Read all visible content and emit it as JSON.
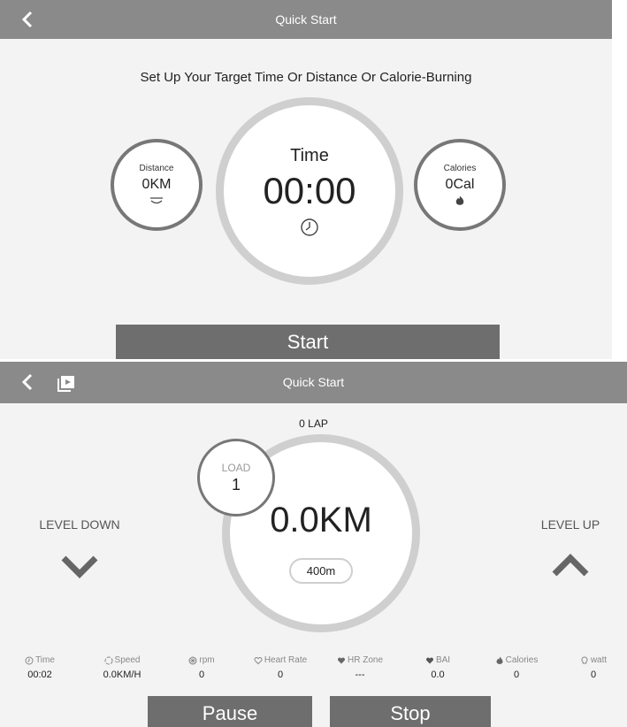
{
  "screen1": {
    "header": {
      "title": "Quick Start"
    },
    "subtitle": "Set Up Your Target Time Or Distance Or Calorie-Burning",
    "distance": {
      "label": "Distance",
      "value": "0KM",
      "icon": "road-icon"
    },
    "time": {
      "label": "Time",
      "value": "00:00",
      "icon": "clock-icon"
    },
    "calories": {
      "label": "Calories",
      "value": "0Cal",
      "icon": "flame-icon"
    },
    "start_label": "Start"
  },
  "screen2": {
    "header": {
      "title": "Quick Start"
    },
    "lap": "0 LAP",
    "load": {
      "label": "LOAD",
      "value": "1"
    },
    "distance_value": "0.0KM",
    "track_length": "400m",
    "level_down": "LEVEL DOWN",
    "level_up": "LEVEL UP",
    "stats": [
      {
        "label": "Time",
        "value": "00:02",
        "icon": "clock-icon"
      },
      {
        "label": "Speed",
        "value": "0.0KM/H",
        "icon": "speed-icon"
      },
      {
        "label": "rpm",
        "value": "0",
        "icon": "wheel-icon"
      },
      {
        "label": "Heart Rate",
        "value": "0",
        "icon": "heart-outline-icon"
      },
      {
        "label": "HR Zone",
        "value": "---",
        "icon": "heart-zone-icon"
      },
      {
        "label": "BAI",
        "value": "0.0",
        "icon": "heart-filled-icon"
      },
      {
        "label": "Calories",
        "value": "0",
        "icon": "flame-icon"
      },
      {
        "label": "watt",
        "value": "0",
        "icon": "bulb-icon"
      }
    ],
    "pause_label": "Pause",
    "stop_label": "Stop"
  },
  "colors": {
    "header_bg": "#8a8a8a",
    "button_bg": "#6e6e6e",
    "ring_light": "#cfcfcf",
    "ring_dark": "#777777",
    "background": "#f3f3f3"
  }
}
